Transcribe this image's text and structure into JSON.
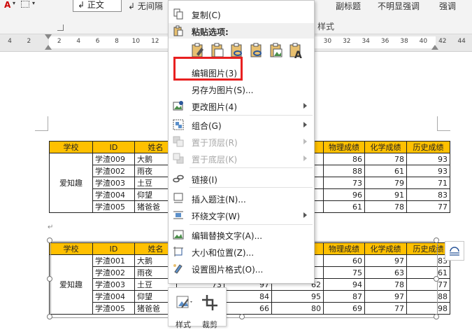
{
  "ribbon": {
    "font_color_btn": "A",
    "style_normal": "↲ 正文",
    "style_no_spacing": "↲ 无间隔",
    "style_subtitle": "副标题",
    "style_subtle_emphasis": "不明显强调",
    "style_emphasis": "强调",
    "group_label": "样式"
  },
  "ruler": {
    "numbers": [
      "4",
      "2",
      "2",
      "4",
      "6",
      "8",
      "10",
      "12",
      "14",
      "16",
      "18",
      "20",
      "22",
      "24",
      "26",
      "28",
      "30",
      "32",
      "34",
      "36",
      "38",
      "40",
      "42",
      "44"
    ]
  },
  "tables": {
    "headers": [
      "学校",
      "ID",
      "姓名",
      "",
      "物理成绩",
      "化学成绩",
      "历史成绩"
    ],
    "school": "爱知趣",
    "top_rows": [
      {
        "id": "学渣009",
        "name": "大鹅",
        "physics": "86",
        "chemistry": "78",
        "history": "93"
      },
      {
        "id": "学渣002",
        "name": "雨夜",
        "physics": "88",
        "chemistry": "61",
        "history": "93"
      },
      {
        "id": "学渣003",
        "name": "土豆",
        "physics": "73",
        "chemistry": "79",
        "history": "71"
      },
      {
        "id": "学渣004",
        "name": "仰望",
        "physics": "96",
        "chemistry": "91",
        "history": "83"
      },
      {
        "id": "学渣005",
        "name": "猪爸爸",
        "physics": "61",
        "chemistry": "78",
        "history": "77"
      }
    ],
    "bottom_headers": [
      "学校",
      "ID",
      "姓名",
      "",
      "",
      "",
      "物理成绩",
      "化学成绩",
      "历史成绩"
    ],
    "bottom_rows": [
      {
        "id": "学渣001",
        "name": "大鹅",
        "c4": "",
        "c5": "",
        "c6": "",
        "physics": "60",
        "chemistry": "97",
        "history": "83"
      },
      {
        "id": "学渣002",
        "name": "雨夜",
        "c4": "",
        "c5": "",
        "c6": "",
        "physics": "75",
        "chemistry": "63",
        "history": "61"
      },
      {
        "id": "学渣003",
        "name": "土豆",
        "c4": "73",
        "c5": "97",
        "c6": "62",
        "physics": "94",
        "chemistry": "78",
        "history": "77"
      },
      {
        "id": "学渣004",
        "name": "仰望",
        "c4": "",
        "c5": "84",
        "c6": "95",
        "physics": "87",
        "chemistry": "97",
        "history": "88"
      },
      {
        "id": "学渣005",
        "name": "猪爸爸",
        "c4": "",
        "c5": "66",
        "c6": "80",
        "physics": "69",
        "chemistry": "77",
        "history": "98"
      }
    ]
  },
  "context_menu": {
    "copy": "复制(C)",
    "paste_options": "粘贴选项:",
    "edit_picture": "编辑图片(3)",
    "save_as_picture": "另存为图片(S)...",
    "change_picture": "更改图片(4)",
    "group": "组合(G)",
    "bring_to_front": "置于顶层(R)",
    "send_to_back": "置于底层(K)",
    "link": "链接(I)",
    "insert_caption": "插入题注(N)...",
    "wrap_text": "环绕文字(W)",
    "edit_alt_text": "编辑替换文字(A)...",
    "size_position": "大小和位置(Z)...",
    "format_picture": "设置图片格式(O)..."
  },
  "mini_toolbar": {
    "style_label": "样式",
    "crop_label": "裁剪"
  },
  "colors": {
    "header_fill": "#ffc000",
    "highlight_border": "#e82020",
    "accent_blue": "#2b579a"
  }
}
